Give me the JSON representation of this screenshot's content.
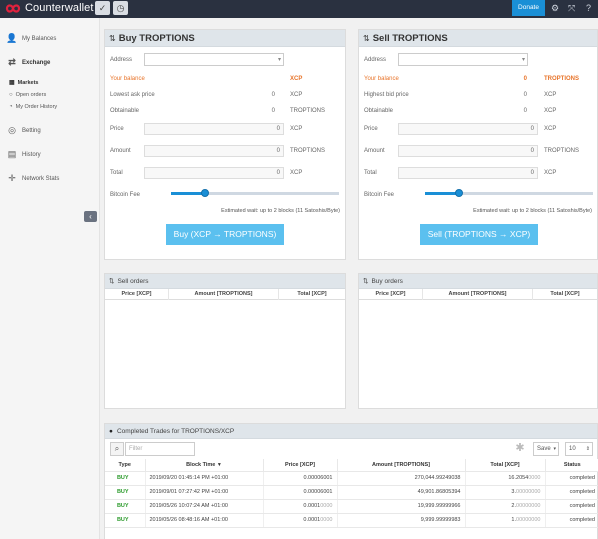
{
  "app": {
    "brand": "Counterwallet",
    "donate": "Donate"
  },
  "sidebar": {
    "items": [
      {
        "label": "My Balances",
        "icon": "user-icon"
      },
      {
        "label": "Exchange",
        "icon": "exchange-icon"
      },
      {
        "label": "Betting",
        "icon": "target-icon"
      },
      {
        "label": "History",
        "icon": "book-icon"
      },
      {
        "label": "Network Stats",
        "icon": "crosshair-icon"
      }
    ],
    "sub": [
      {
        "label": "Markets"
      },
      {
        "label": "Open orders"
      },
      {
        "label": "My Order History"
      }
    ]
  },
  "buy": {
    "title": "Buy TROPTIONS",
    "address_label": "Address",
    "your_balance": "Your balance",
    "balance_unit": "XCP",
    "lowest_label": "Lowest ask price",
    "lowest_val": "0",
    "lowest_unit": "XCP",
    "obtainable_label": "Obtainable",
    "obtainable_val": "0",
    "obtainable_unit": "TROPTIONS",
    "price_label": "Price",
    "price_val": "0",
    "price_unit": "XCP",
    "amount_label": "Amount",
    "amount_val": "0",
    "amount_unit": "TROPTIONS",
    "total_label": "Total",
    "total_val": "0",
    "total_unit": "XCP",
    "fee_label": "Bitcoin Fee",
    "fee_fraction": 0.2,
    "wait": "Estimated wait: up to 2 blocks (11 Satoshis/Byte)",
    "button": "Buy (XCP → TROPTIONS)"
  },
  "sell": {
    "title": "Sell TROPTIONS",
    "address_label": "Address",
    "your_balance": "Your balance",
    "balance_val": "0",
    "balance_unit": "TROPTIONS",
    "highest_label": "Highest bid price",
    "highest_val": "0",
    "highest_unit": "XCP",
    "obtainable_label": "Obtainable",
    "obtainable_val": "0",
    "obtainable_unit": "XCP",
    "price_label": "Price",
    "price_val": "0",
    "price_unit": "XCP",
    "amount_label": "Amount",
    "amount_val": "0",
    "amount_unit": "TROPTIONS",
    "total_label": "Total",
    "total_val": "0",
    "total_unit": "XCP",
    "fee_label": "Bitcoin Fee",
    "fee_fraction": 0.2,
    "wait": "Estimated wait: up to 2 blocks (11 Satoshis/Byte)",
    "button": "Sell (TROPTIONS → XCP)"
  },
  "sell_orders": {
    "title": "Sell orders",
    "cols": [
      "Price [XCP]",
      "Amount [TROPTIONS]",
      "Total [XCP]"
    ]
  },
  "buy_orders": {
    "title": "Buy orders",
    "cols": [
      "Price [XCP]",
      "Amount [TROPTIONS]",
      "Total [XCP]"
    ]
  },
  "trades": {
    "title": "Completed Trades for TROPTIONS/XCP",
    "filter_placeholder": "Filter",
    "save": "Save",
    "page_size": "10",
    "cols": [
      "Type",
      "Block Time",
      "Price [XCP]",
      "Amount [TROPTIONS]",
      "Total [XCP]",
      "Status"
    ],
    "rows": [
      {
        "type": "BUY",
        "time": "2019/09/20 01:45:14 PM +01:00",
        "price": "0.00006001",
        "amount_a": "270,044.9",
        "amount_b": "9249038",
        "total_a": "16.2054",
        "total_b": "0000",
        "status": "completed"
      },
      {
        "type": "BUY",
        "time": "2019/09/01 07:27:42 PM +01:00",
        "price": "0.00006001",
        "amount_a": "49,901.8",
        "amount_b": "6805394",
        "total_a": "3.",
        "total_b": "00000000",
        "status": "completed"
      },
      {
        "type": "BUY",
        "time": "2019/05/26 10:07:24 AM +01:00",
        "price": "0.0001",
        "price_b": "0000",
        "amount_a": "19,999.9",
        "amount_b": "9999966",
        "total_a": "2.",
        "total_b": "00000000",
        "status": "completed"
      },
      {
        "type": "BUY",
        "time": "2019/05/26 08:48:16 AM +01:00",
        "price": "0.0001",
        "price_b": "0000",
        "amount_a": "9,999.9",
        "amount_b": "9999983",
        "total_a": "1.",
        "total_b": "00000000",
        "status": "completed"
      }
    ]
  },
  "colors": {
    "topbar": "#2a3140",
    "accent": "#1a8fd6",
    "balance": "#e8742a",
    "buy": "#2b9a2b"
  }
}
